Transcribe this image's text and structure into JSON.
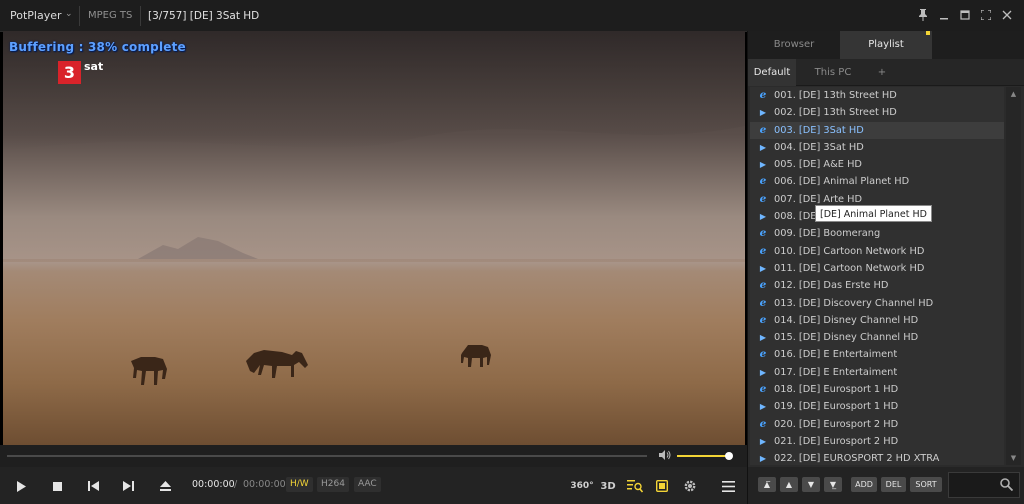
{
  "titlebar": {
    "app_name": "PotPlayer",
    "format": "MPEG TS",
    "title": "[3/757] [DE] 3Sat HD"
  },
  "video": {
    "buffering_text": "Buffering : 38% complete",
    "buffering_percent": 38,
    "channel_logo_mark": "3",
    "channel_logo_text": "sat"
  },
  "volume": {
    "level": 1.0
  },
  "controls": {
    "time_current": "00:00:00",
    "time_separator": "/",
    "time_total": "00:00:00",
    "hw_label": "H/W",
    "video_codec": "H264",
    "audio_codec": "AAC",
    "vr_label": "360°",
    "three_d_label": "3D"
  },
  "panel": {
    "tabs": [
      "Browser",
      "Playlist"
    ],
    "active_tab": "Playlist",
    "sub_tabs": [
      "Default",
      "This PC",
      "+"
    ],
    "active_sub_tab": "Default",
    "tooltip": "[DE] Animal Planet HD",
    "items": [
      {
        "label": "001. [DE] 13th Street HD",
        "icon": "ie-icon"
      },
      {
        "label": "002. [DE] 13th Street HD",
        "icon": "play-icon"
      },
      {
        "label": "003. [DE] 3Sat HD",
        "icon": "ie-icon",
        "selected": true
      },
      {
        "label": "004. [DE] 3Sat HD",
        "icon": "play-icon"
      },
      {
        "label": "005. [DE] A&E HD",
        "icon": "play-icon"
      },
      {
        "label": "006. [DE] Animal Planet HD",
        "icon": "ie-icon"
      },
      {
        "label": "007. [DE] Arte HD",
        "icon": "ie-icon"
      },
      {
        "label": "008. [DE]",
        "icon": "play-icon"
      },
      {
        "label": "009. [DE] Boomerang",
        "icon": "ie-icon"
      },
      {
        "label": "010. [DE] Cartoon Network HD",
        "icon": "ie-icon"
      },
      {
        "label": "011. [DE] Cartoon Network HD",
        "icon": "play-icon"
      },
      {
        "label": "012. [DE] Das Erste HD",
        "icon": "ie-icon"
      },
      {
        "label": "013. [DE] Discovery Channel HD",
        "icon": "ie-icon"
      },
      {
        "label": "014. [DE] Disney Channel HD",
        "icon": "ie-icon"
      },
      {
        "label": "015. [DE] Disney Channel HD",
        "icon": "play-icon"
      },
      {
        "label": "016. [DE] E Entertaiment",
        "icon": "ie-icon"
      },
      {
        "label": "017. [DE] E Entertaiment",
        "icon": "play-icon"
      },
      {
        "label": "018. [DE] Eurosport 1 HD",
        "icon": "ie-icon"
      },
      {
        "label": "019. [DE] Eurosport 1 HD",
        "icon": "play-icon"
      },
      {
        "label": "020. [DE] Eurosport 2 HD",
        "icon": "ie-icon"
      },
      {
        "label": "021. [DE] Eurosport 2 HD",
        "icon": "play-icon"
      },
      {
        "label": "022. [DE] EUROSPORT 2 HD XTRA",
        "icon": "play-icon"
      }
    ],
    "buttons": {
      "add": "ADD",
      "del": "DEL",
      "sort": "SORT"
    }
  },
  "colors": {
    "accent_yellow": "#f3d436",
    "buffer_blue": "#5da0ff",
    "selected_text": "#8ac1ff",
    "logo_red": "#d9232a"
  }
}
